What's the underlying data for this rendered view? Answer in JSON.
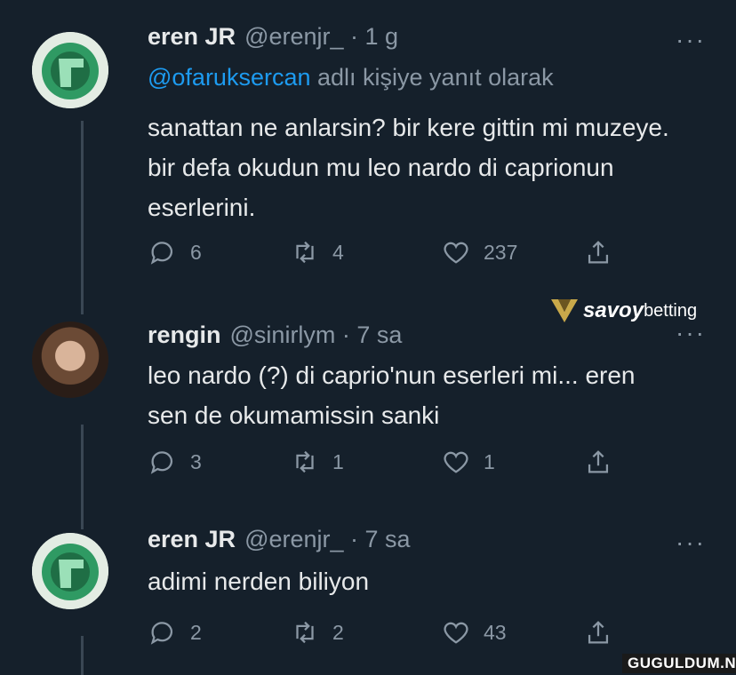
{
  "tweets": [
    {
      "name": "eren JR",
      "handle": "@erenjr_ · 1 g",
      "reply_prefix": "@ofaruksercan",
      "reply_suffix": " adlı kişiye yanıt olarak",
      "text": "sanattan ne anlarsin? bir kere gittin mi muzeye. bir defa okudun mu leo nardo di caprionun eserlerini.",
      "replies": "6",
      "retweets": "4",
      "likes": "237",
      "more": "···"
    },
    {
      "name": "rengin",
      "handle": "@sinirlym · 7 sa",
      "text": "leo nardo (?) di caprio'nun eserleri mi... eren sen de okumamissin sanki",
      "replies": "3",
      "retweets": "1",
      "likes": "1",
      "more": "···"
    },
    {
      "name": "eren JR",
      "handle": "@erenjr_ · 7 sa",
      "text": "adimi nerden biliyon",
      "replies": "2",
      "retweets": "2",
      "likes": "43",
      "more": "···"
    }
  ],
  "sponsor": {
    "part1": "savoy",
    "part2": "betting"
  },
  "watermark": "GUGULDUM.NET",
  "colors": {
    "background": "#15202b",
    "text": "#e7e9ea",
    "muted": "#8b98a5",
    "link": "#1d9bf0",
    "avatar_green": "#2f9a63"
  },
  "icons": [
    "reply-icon",
    "retweet-icon",
    "like-icon",
    "share-icon",
    "more-icon"
  ]
}
